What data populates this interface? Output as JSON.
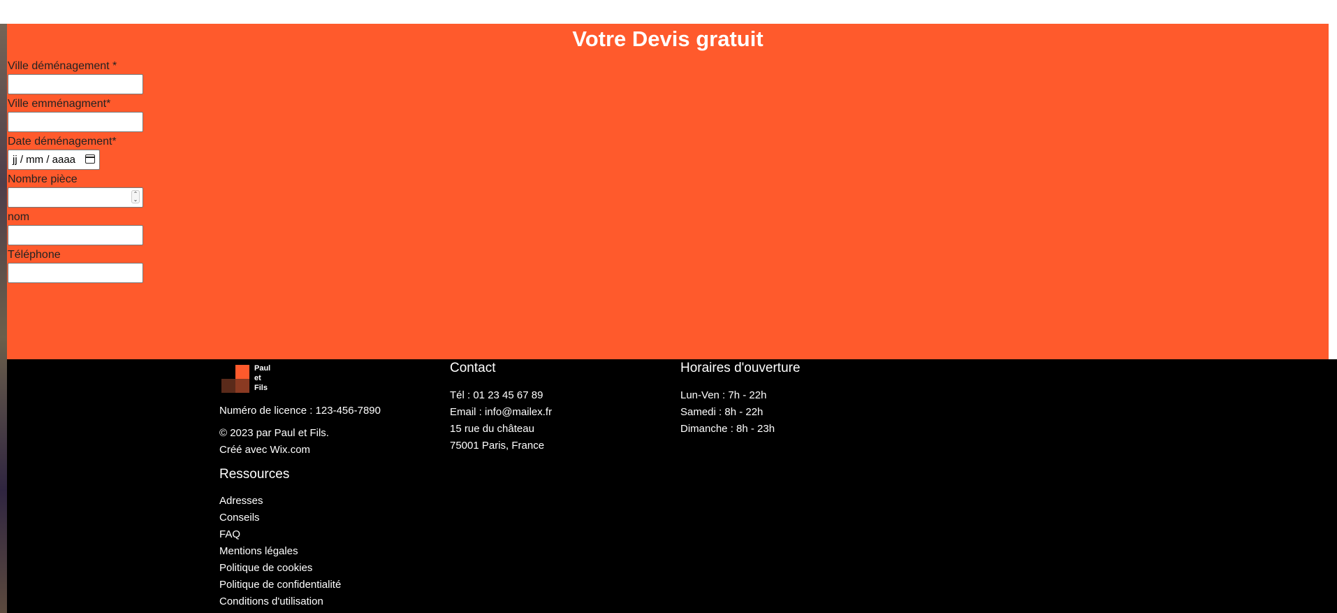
{
  "quote": {
    "title": "Votre Devis gratuit",
    "fields": {
      "departure_city": {
        "label": "Ville déménagement *",
        "value": ""
      },
      "arrival_city": {
        "label": "Ville emménagment*",
        "value": ""
      },
      "move_date": {
        "label": "Date déménagement*",
        "placeholder": "jj / mm / aaaa"
      },
      "rooms": {
        "label": "Nombre pièce",
        "value": ""
      },
      "name": {
        "label": "nom",
        "value": ""
      },
      "phone": {
        "label": "Téléphone",
        "value": ""
      }
    }
  },
  "footer": {
    "logo_text": "Paul\net\nFils",
    "license": "Numéro de licence : 123-456-7890",
    "copyright": "© 2023 par Paul et Fils.",
    "made_with": "Créé avec Wix.com",
    "resources_title": "Ressources",
    "resources": [
      "Adresses",
      "Conseils",
      "FAQ",
      "Mentions légales",
      "Politique de cookies",
      "Politique de confidentialité",
      "Conditions d'utilisation"
    ],
    "contact_title": "Contact",
    "contact": [
      "Tél : 01 23 45 67 89",
      "Email : info@mailex.fr",
      "15 rue du château",
      "75001 Paris, France"
    ],
    "hours_title": "Horaires d'ouverture",
    "hours": [
      "Lun-Ven : 7h - 22h",
      "Samedi : 8h - 22h",
      "Dimanche : 8h - 23h"
    ]
  },
  "colors": {
    "accent": "#ff5a2c",
    "footer_bg": "#000000",
    "logo_dark": "#5a2a1a",
    "logo_mid": "#8a3a22"
  },
  "icons": [
    "calendar-icon",
    "spinner-arrows-icon"
  ]
}
